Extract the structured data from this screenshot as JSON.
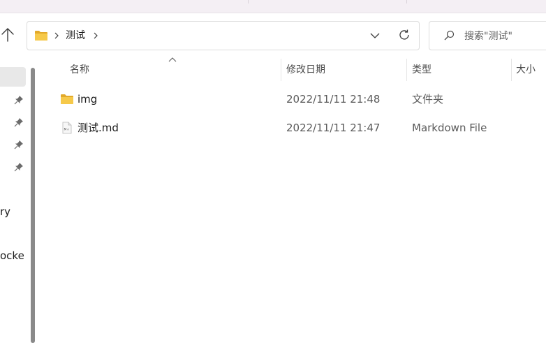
{
  "address_bar": {
    "crumbs": [
      "测试"
    ],
    "folder_icon": "folder-icon",
    "dropdown_icon": "chevron-down-icon",
    "refresh_icon": "refresh-icon"
  },
  "search": {
    "placeholder": "搜索\"测试\""
  },
  "nav_pane": {
    "partial_labels": [
      "ry",
      "ocke"
    ],
    "pins": 4
  },
  "columns": {
    "name": "名称",
    "date_modified": "修改日期",
    "type": "类型",
    "size": "大小"
  },
  "files": [
    {
      "name": "img",
      "date": "2022/11/11 21:48",
      "type": "文件夹",
      "icon": "folder-icon"
    },
    {
      "name": "测试.md",
      "date": "2022/11/11 21:47",
      "type": "Markdown File",
      "icon": "markdown-file-icon"
    }
  ],
  "colors": {
    "folder_yellow": "#f6c94a",
    "folder_dark": "#e2a92a",
    "selection": "#e8e8e8",
    "scrollbar": "#8a8a8a"
  }
}
